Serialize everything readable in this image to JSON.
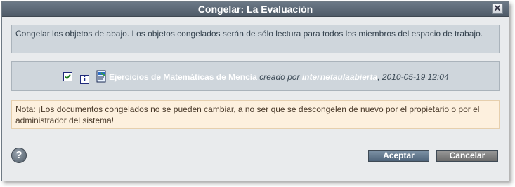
{
  "dialog": {
    "title": "Congelar: La Evaluación",
    "close_label": "✕",
    "description": "Congelar los objetos de abajo. Los objetos congelados serán de sólo lectura para todos los miembros del espacio de trabajo.",
    "item": {
      "info_label": "i",
      "title": "Ejercicios de Matemáticas de Mencía",
      "created_by_label": "creado por",
      "author": "internetaulaabierta",
      "date": ", 2010-05-19 12:04",
      "checked": true
    },
    "note": "Nota: ¡Los documentos congelados no se pueden cambiar, a no ser que se descongelen de nuevo por el propietario o por el administrador del sistema!",
    "help_label": "?",
    "buttons": {
      "accept": "Aceptar",
      "cancel": "Cancelar"
    }
  },
  "colors": {
    "titlebar": "#5b6876",
    "panel": "#cfd6dc",
    "note_bg": "#fdf0de",
    "accept": "#5f7489",
    "cancel": "#838383"
  },
  "icons": [
    "close-icon",
    "checkbox-icon",
    "info-icon",
    "document-icon",
    "help-icon"
  ]
}
